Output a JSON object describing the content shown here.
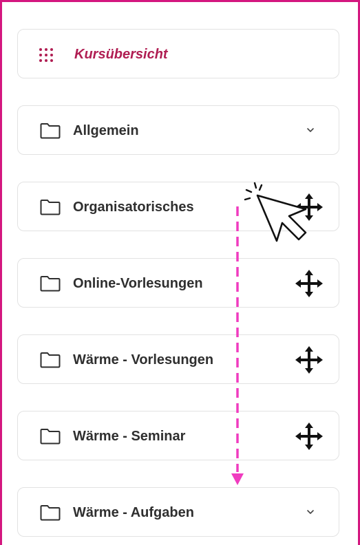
{
  "overview": {
    "label": "Kursübersicht",
    "icon": "grid-dots-icon",
    "color": "#b01e53"
  },
  "sections": [
    {
      "label": "Allgemein",
      "icon": "folder-icon",
      "control": "chevron-down-icon"
    },
    {
      "label": "Organisatorisches",
      "icon": "folder-icon",
      "control": "move-icon"
    },
    {
      "label": "Online-Vorlesungen",
      "icon": "folder-icon",
      "control": "move-icon"
    },
    {
      "label": "Wärme - Vorlesungen",
      "icon": "folder-icon",
      "control": "move-icon"
    },
    {
      "label": "Wärme - Seminar",
      "icon": "folder-icon",
      "control": "move-icon"
    },
    {
      "label": "Wärme - Aufgaben",
      "icon": "folder-icon",
      "control": "chevron-down-icon"
    }
  ],
  "annotation": {
    "arrow_color": "#f03cbf",
    "frame_color": "#d4177f",
    "cursor_icon": "click-cursor-icon"
  }
}
